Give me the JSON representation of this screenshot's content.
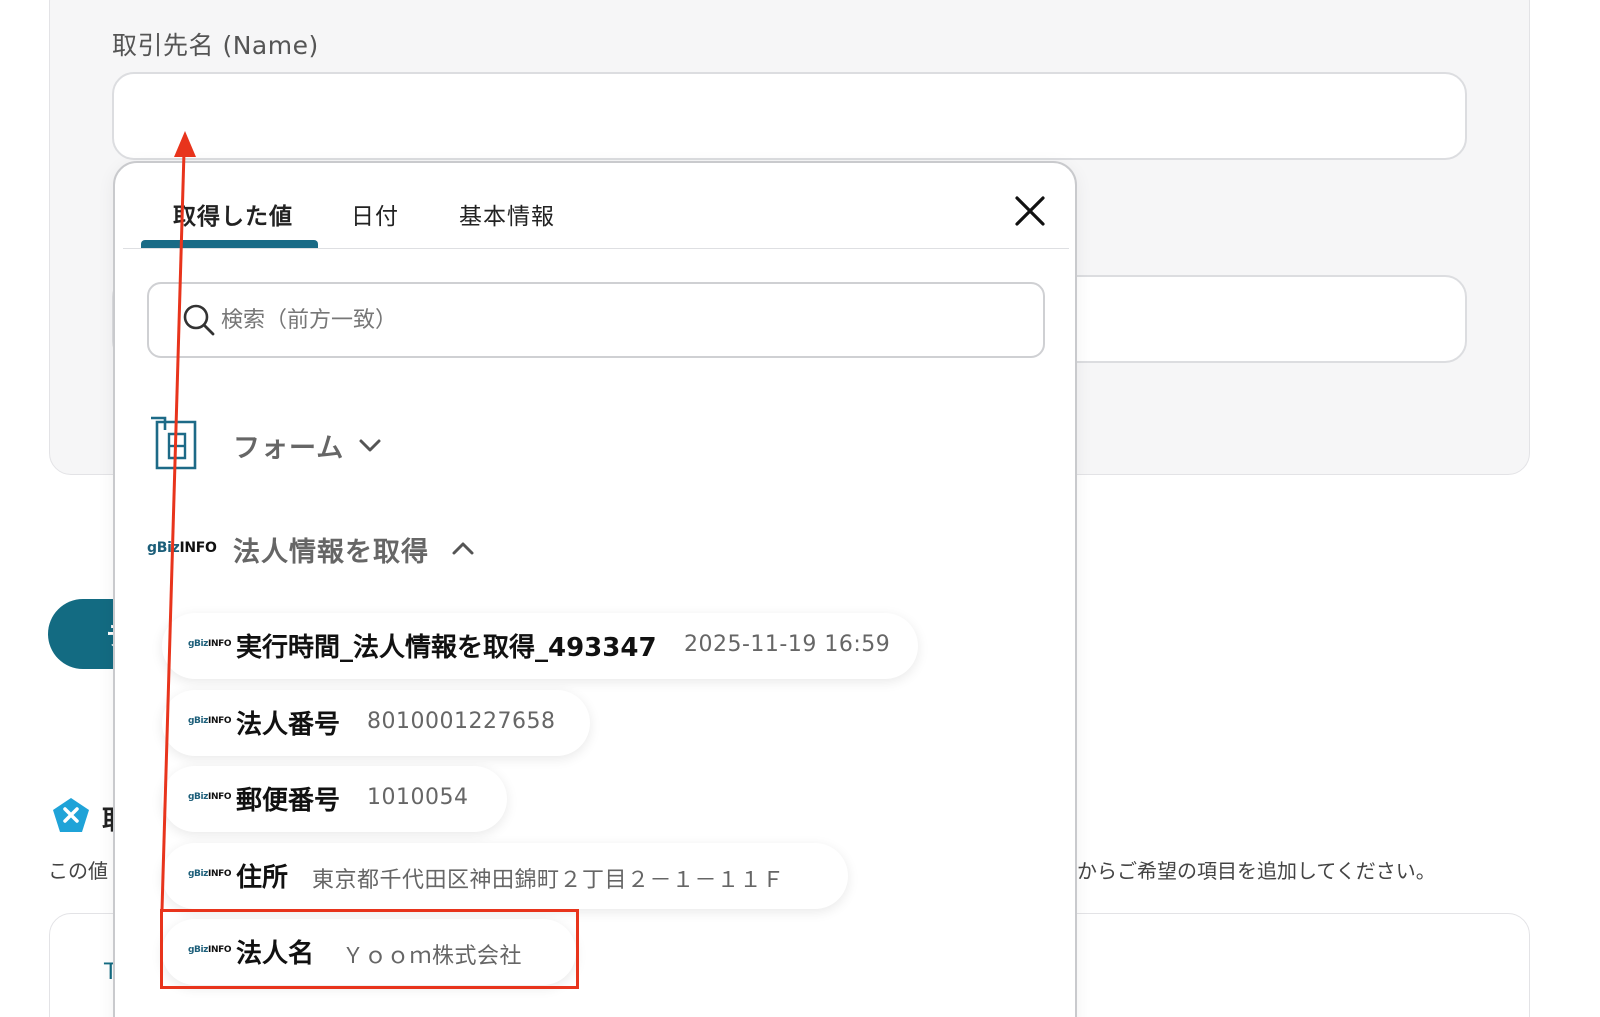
{
  "form": {
    "field_label": "取引先名 (Name)",
    "name_value": "",
    "teal_button_label": "テ"
  },
  "section": {
    "title_fragment": "取",
    "helper_left": "この値",
    "helper_right": "からご希望の項目を追加してください。",
    "lower_card_fragment": "T"
  },
  "panel": {
    "tabs": [
      {
        "label": "取得した値",
        "active": true
      },
      {
        "label": "日付",
        "active": false
      },
      {
        "label": "基本情報",
        "active": false
      }
    ],
    "search_placeholder": "検索（前方一致）",
    "groups": [
      {
        "label": "フォーム",
        "icon": "form-icon",
        "expanded": false
      },
      {
        "label": "法人情報を取得",
        "icon": "gbizinfo-logo",
        "expanded": true
      }
    ],
    "logo_text": {
      "colored": "gBiz",
      "dark": "INFO"
    },
    "items": [
      {
        "key": "実行時間_法人情報を取得_493347",
        "value": "2025-11-19 16:59"
      },
      {
        "key": "法人番号",
        "value": "8010001227658"
      },
      {
        "key": "郵便番号",
        "value": "1010054"
      },
      {
        "key": "住所",
        "value": "東京都千代田区神田錦町２丁目２－１－１１Ｆ"
      },
      {
        "key": "法人名",
        "value": "Ｙｏｏｍ株式会社"
      }
    ]
  },
  "colors": {
    "accent": "#1a6b86",
    "annotation": "#e8341c",
    "x_badge": "#1fa3d8"
  }
}
